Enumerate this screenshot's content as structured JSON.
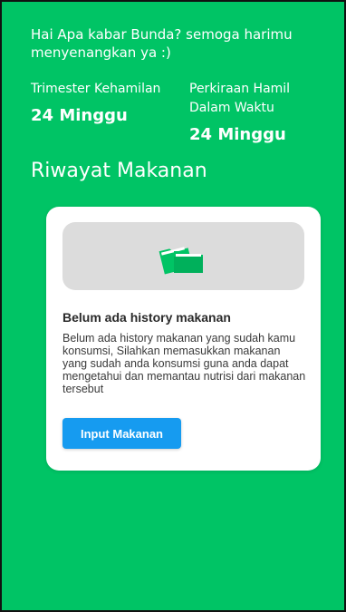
{
  "header": {
    "greeting": "Hai Apa kabar Bunda? semoga harimu menyenangkan ya :)",
    "trimester_label": "Trimester Kehamilan",
    "trimester_value": "24 Minggu",
    "due_label": "Perkiraan Hamil Dalam Waktu",
    "due_value": "24 Minggu"
  },
  "section": {
    "title": "Riwayat Makanan"
  },
  "empty_state": {
    "icon": "folders-icon",
    "title": "Belum ada history makanan",
    "body": "Belum ada history makanan yang sudah kamu konsumsi, Silahkan memasukkan makanan yang sudah anda konsumsi guna anda dapat mengetahui dan memantau nutrisi dari makanan tersebut",
    "button_label": "Input Makanan"
  },
  "colors": {
    "background": "#00c465",
    "card": "#ffffff",
    "image_placeholder": "#dcdcdc",
    "button": "#169bf0",
    "icon": "#00c465"
  }
}
